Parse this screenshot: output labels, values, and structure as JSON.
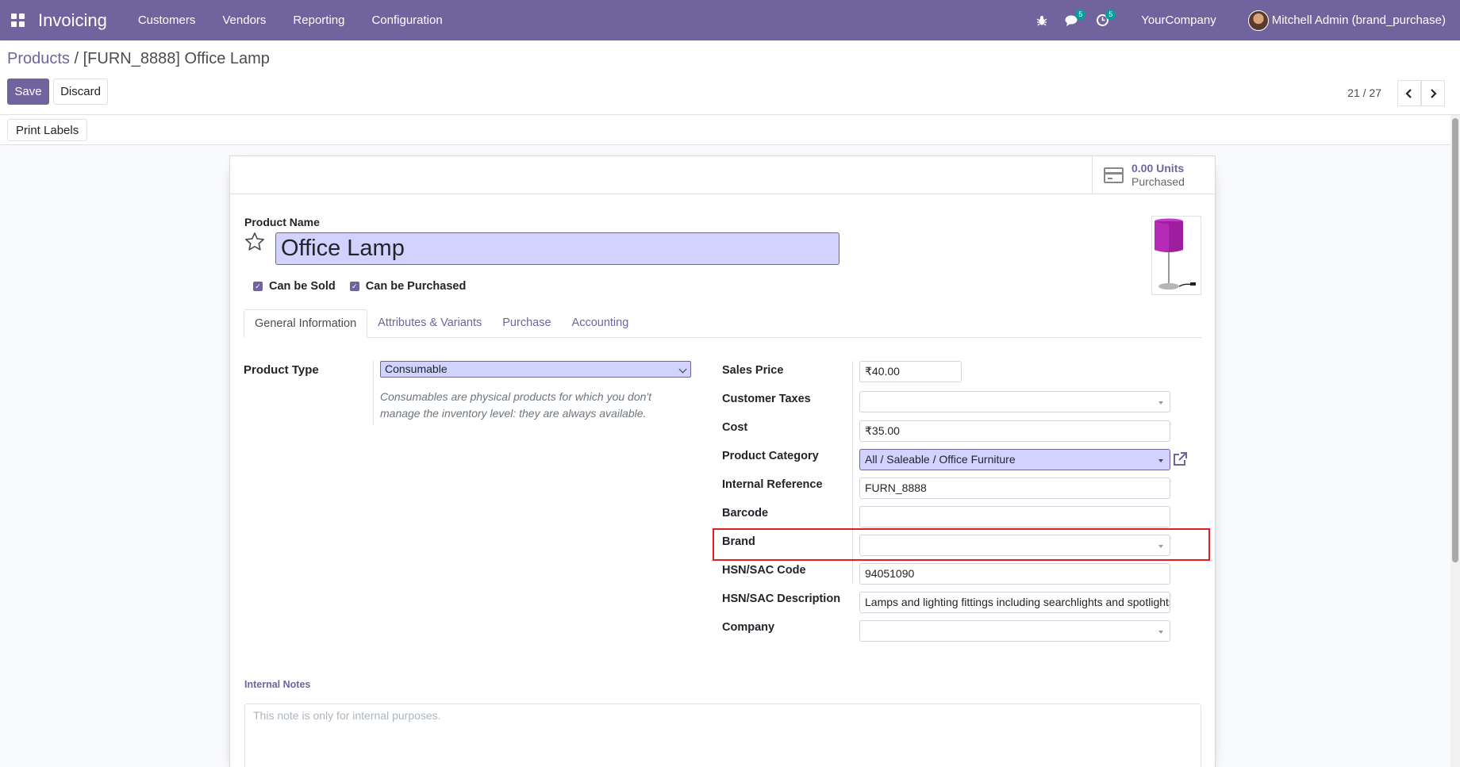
{
  "navbar": {
    "app_name": "Invoicing",
    "menu": [
      "Customers",
      "Vendors",
      "Reporting",
      "Configuration"
    ],
    "messages_count": "5",
    "activities_count": "5",
    "company": "YourCompany",
    "user": "Mitchell Admin (brand_purchase)",
    "color": "#71639e"
  },
  "breadcrumb": {
    "parent": "Products",
    "separator": "/",
    "current": "[FURN_8888] Office Lamp"
  },
  "actions": {
    "save": "Save",
    "discard": "Discard"
  },
  "pager": {
    "text": "21 / 27"
  },
  "statusbar": {
    "print_labels": "Print Labels"
  },
  "stat_button": {
    "value": "0.00 Units",
    "label": "Purchased"
  },
  "product": {
    "name_label": "Product Name",
    "name": "Office Lamp",
    "can_be_sold": "Can be Sold",
    "can_be_purchased": "Can be Purchased"
  },
  "tabs": [
    "General Information",
    "Attributes & Variants",
    "Purchase",
    "Accounting"
  ],
  "general": {
    "product_type_label": "Product Type",
    "product_type_value": "Consumable",
    "product_type_help": "Consumables are physical products for which you don't manage the inventory level: they are always available."
  },
  "fields": {
    "sales_price": {
      "label": "Sales Price",
      "value": "₹40.00"
    },
    "customer_taxes": {
      "label": "Customer Taxes",
      "value": ""
    },
    "cost": {
      "label": "Cost",
      "value": "₹35.00"
    },
    "product_category": {
      "label": "Product Category",
      "value": "All / Saleable / Office Furniture"
    },
    "internal_reference": {
      "label": "Internal Reference",
      "value": "FURN_8888"
    },
    "barcode": {
      "label": "Barcode",
      "value": ""
    },
    "brand": {
      "label": "Brand",
      "value": ""
    },
    "hsn_code": {
      "label": "HSN/SAC Code",
      "value": "94051090"
    },
    "hsn_description": {
      "label": "HSN/SAC Description",
      "value": "Lamps and lighting fittings including searchlights and spotlights"
    },
    "company": {
      "label": "Company",
      "value": ""
    }
  },
  "notes": {
    "label": "Internal Notes",
    "placeholder": "This note is only for internal purposes."
  },
  "highlight_color": "#e02020"
}
